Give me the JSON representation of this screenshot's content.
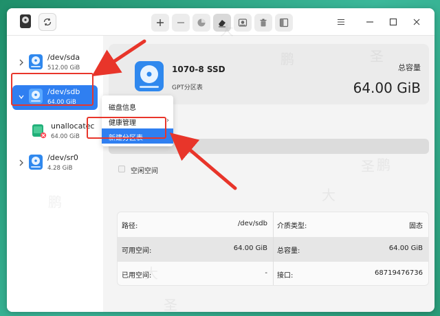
{
  "toolbar": {
    "icons": [
      "plus-icon",
      "minus-icon",
      "pie-icon",
      "eraser-icon",
      "image-disk-icon",
      "trash-icon",
      "layout-icon"
    ]
  },
  "window_controls": [
    "menu-icon",
    "minimize-icon",
    "maximize-icon",
    "close-icon"
  ],
  "sidebar": {
    "items": [
      {
        "name": "/dev/sda",
        "size": "512.00 GiB"
      },
      {
        "name": "/dev/sdb",
        "size": "64.00 GiB"
      },
      {
        "name": "unallocatec",
        "size": "64.00 GiB"
      },
      {
        "name": "/dev/sr0",
        "size": "4.28 GiB"
      }
    ]
  },
  "disk": {
    "title": "1070-8 SSD",
    "subtitle": "GPT分区表",
    "capacity_label": "总容量",
    "capacity_value": "64.00 GiB"
  },
  "legend": {
    "free_label": "空闲空间"
  },
  "context_menu": {
    "items": [
      "磁盘信息",
      "健康管理",
      "新建分区表"
    ],
    "submenu_arrow": "›"
  },
  "info_table": {
    "rows": [
      {
        "l_label": "路径:",
        "l_value": "/dev/sdb",
        "r_label": "介质类型:",
        "r_value": "固态"
      },
      {
        "l_label": "可用空间:",
        "l_value": "64.00 GiB",
        "r_label": "总容量:",
        "r_value": "64.00 GiB"
      },
      {
        "l_label": "已用空间:",
        "l_value": "-",
        "r_label": "接口:",
        "r_value": "68719476736"
      }
    ]
  },
  "watermarks": [
    "鹏",
    "大",
    "圣",
    "鹏",
    "大",
    "圣",
    "鹏",
    "大",
    "圣"
  ],
  "colors": {
    "accent": "#2f7ff1",
    "annotation": "#e8352a"
  }
}
